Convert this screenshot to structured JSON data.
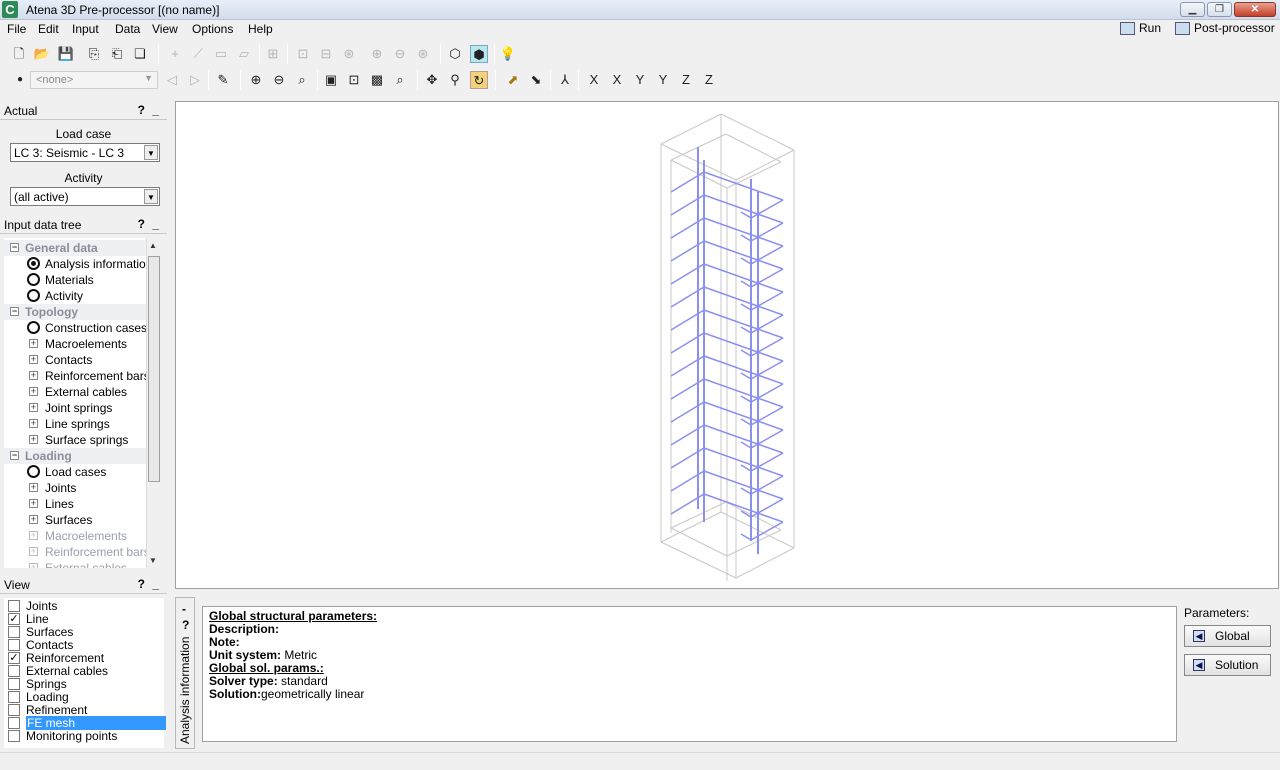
{
  "window": {
    "title": "Atena 3D Pre-processor [(no name)]",
    "app_icon": "C"
  },
  "menu": [
    "File",
    "Edit",
    "Input",
    "Data",
    "View",
    "Options",
    "Help"
  ],
  "top_right": {
    "run": "Run",
    "post": "Post-processor"
  },
  "toolbar2": {
    "combo_value": "<none>"
  },
  "actual": {
    "header": "Actual",
    "help": "?",
    "minimize": "_",
    "load_case_label": "Load case",
    "load_case_value": "LC 3: Seismic - LC 3",
    "activity_label": "Activity",
    "activity_value": "(all active)"
  },
  "tree": {
    "header": "Input data tree",
    "help": "?",
    "minimize": "_",
    "items": [
      {
        "label": "General data",
        "kind": "group"
      },
      {
        "label": "Analysis information",
        "kind": "radio-on"
      },
      {
        "label": "Materials",
        "kind": "radio"
      },
      {
        "label": "Activity",
        "kind": "radio"
      },
      {
        "label": "Topology",
        "kind": "group"
      },
      {
        "label": "Construction cases",
        "kind": "radio"
      },
      {
        "label": "Macroelements",
        "kind": "plus"
      },
      {
        "label": "Contacts",
        "kind": "plus"
      },
      {
        "label": "Reinforcement bars",
        "kind": "plus"
      },
      {
        "label": "External cables",
        "kind": "plus"
      },
      {
        "label": "Joint springs",
        "kind": "plus"
      },
      {
        "label": "Line springs",
        "kind": "plus"
      },
      {
        "label": "Surface springs",
        "kind": "plus"
      },
      {
        "label": "Loading",
        "kind": "group"
      },
      {
        "label": "Load cases",
        "kind": "radio"
      },
      {
        "label": "Joints",
        "kind": "plus"
      },
      {
        "label": "Lines",
        "kind": "plus"
      },
      {
        "label": "Surfaces",
        "kind": "plus"
      },
      {
        "label": "Macroelements",
        "kind": "plus-dim"
      },
      {
        "label": "Reinforcement bars",
        "kind": "plus-dim"
      },
      {
        "label": "External cables",
        "kind": "plus-dim"
      }
    ]
  },
  "view": {
    "header": "View",
    "help": "?",
    "minimize": "_",
    "items": [
      {
        "label": "Joints",
        "checked": false
      },
      {
        "label": "Line",
        "checked": true
      },
      {
        "label": "Surfaces",
        "checked": false
      },
      {
        "label": "Contacts",
        "checked": false
      },
      {
        "label": "Reinforcement",
        "checked": true
      },
      {
        "label": "External cables",
        "checked": false
      },
      {
        "label": "Springs",
        "checked": false
      },
      {
        "label": "Loading",
        "checked": false
      },
      {
        "label": "Refinement",
        "checked": false
      },
      {
        "label": "FE mesh",
        "checked": false,
        "selected": true
      },
      {
        "label": "Monitoring points",
        "checked": false
      }
    ]
  },
  "bottom": {
    "tab_label": "Analysis information",
    "help": "?",
    "minimize": "-",
    "info": {
      "heading": "Global structural parameters:",
      "description_label": "Description:",
      "note_label": "Note:",
      "unit_label": "Unit system:",
      "unit_value": "Metric",
      "sol_heading": "Global sol. params.:",
      "solver_label": "Solver type:",
      "solver_value": "standard",
      "solution_label": "Solution:",
      "solution_value": "geometrically linear"
    },
    "params_label": "Parameters:",
    "global_btn": "Global",
    "solution_btn": "Solution"
  },
  "colors": {
    "wire": "#c8c8c8",
    "rebar": "#8b8ff0",
    "selection": "#3399ff"
  }
}
